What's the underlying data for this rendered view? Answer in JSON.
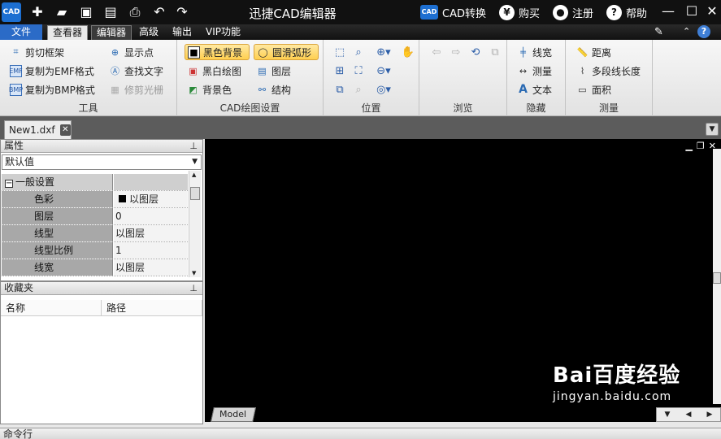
{
  "titlebar": {
    "title": "迅捷CAD编辑器",
    "cad_convert": "CAD转换",
    "buy": "购买",
    "register": "注册",
    "help": "帮助",
    "logo_text": "CAD"
  },
  "menu": {
    "file": "文件",
    "tabs": [
      "查看器",
      "编辑器",
      "高级",
      "输出",
      "VIP功能"
    ]
  },
  "ribbon": {
    "tools": {
      "label": "工具",
      "items": [
        "剪切框架",
        "复制为EMF格式",
        "复制为BMP格式",
        "显示点",
        "查找文字",
        "修剪光栅"
      ]
    },
    "cad_settings": {
      "label": "CAD绘图设置",
      "items": [
        "黑色背景",
        "黑白绘图",
        "背景色",
        "圆滑弧形",
        "图层",
        "结构"
      ]
    },
    "position": {
      "label": "位置"
    },
    "browse": {
      "label": "浏览"
    },
    "hide": {
      "label": "隐藏",
      "items": [
        "线宽",
        "测量",
        "文本"
      ]
    },
    "measure": {
      "label": "测量",
      "items": [
        "距离",
        "多段线长度",
        "面积"
      ]
    }
  },
  "doc": {
    "tab": "New1.dxf"
  },
  "properties": {
    "title": "属性",
    "select_value": "默认值",
    "group": "一般设置",
    "rows": [
      {
        "key": "色彩",
        "value": "以图层"
      },
      {
        "key": "图层",
        "value": "0"
      },
      {
        "key": "线型",
        "value": "以图层"
      },
      {
        "key": "线型比例",
        "value": "1"
      },
      {
        "key": "线宽",
        "value": "以图层"
      }
    ]
  },
  "favorites": {
    "title": "收藏夹",
    "columns": [
      "名称",
      "路径"
    ]
  },
  "canvas": {
    "model_tab": "Model",
    "background": "#000000",
    "watermark": "Bai百度经验",
    "watermark_sub": "jingyan.baidu.com"
  },
  "command": {
    "title": "命令行"
  },
  "colors": {
    "accent": "#2b6bc7",
    "highlight": "#ffcf4f"
  }
}
